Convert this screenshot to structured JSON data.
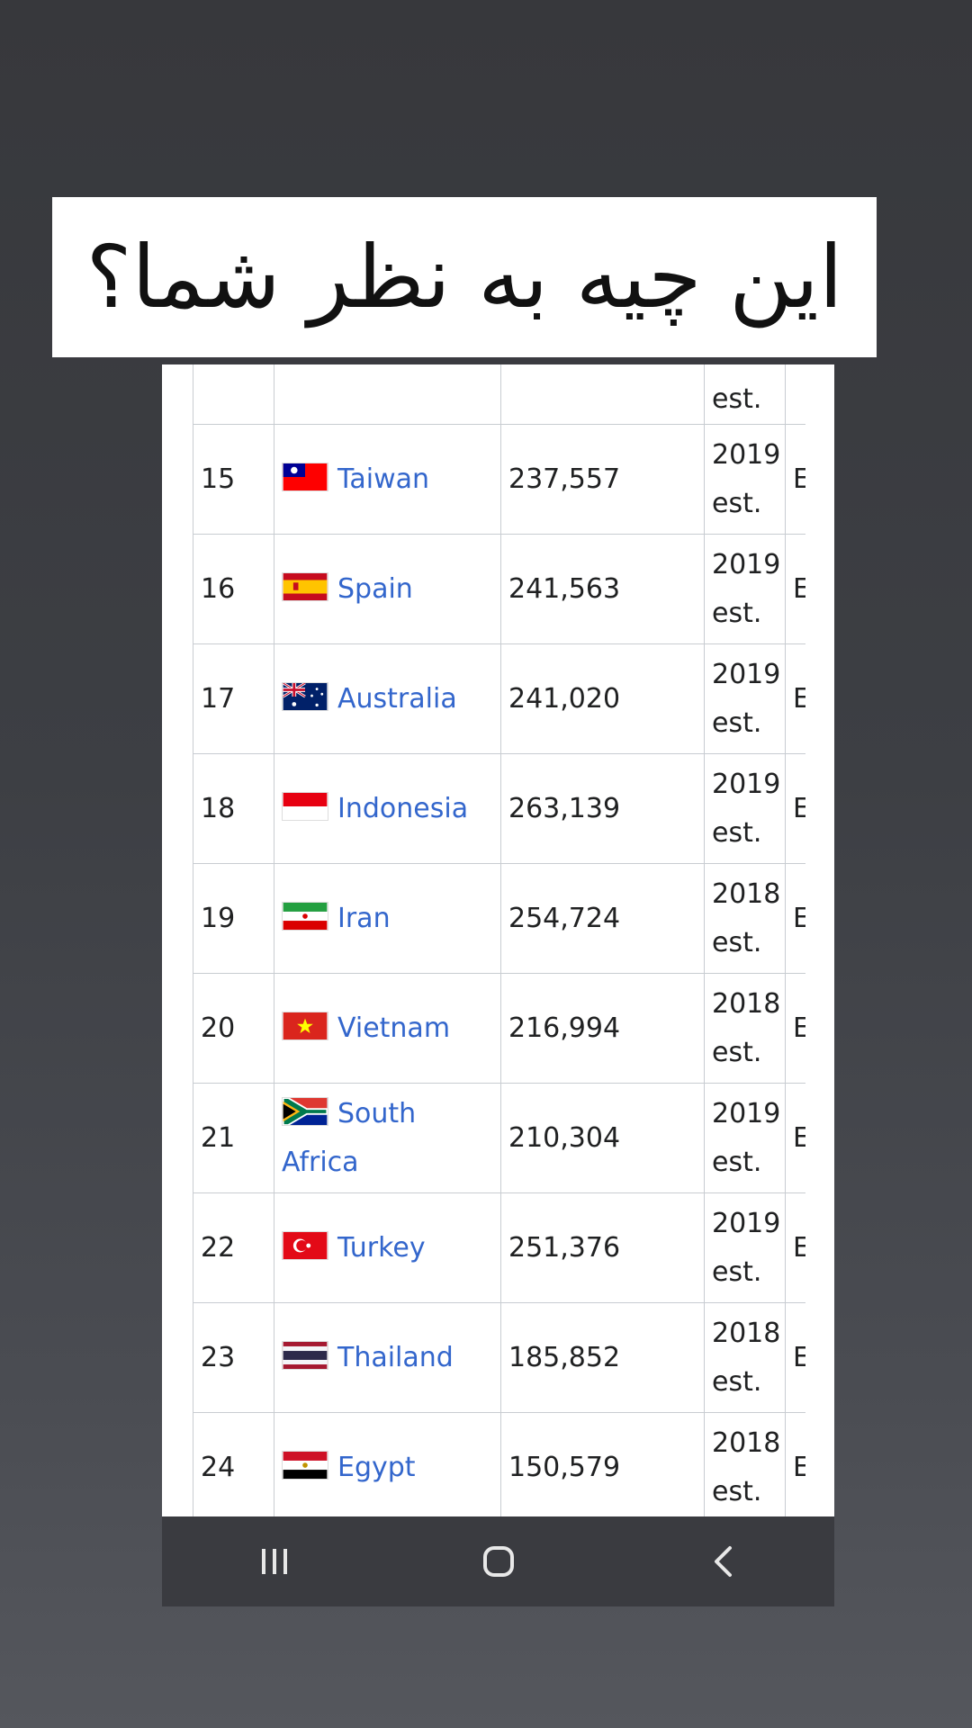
{
  "caption": {
    "text": "این چیه به نظر شما؟"
  },
  "table": {
    "top_partial": {
      "year_suffix": "est."
    },
    "rows": [
      {
        "rank": "15",
        "flag_icon": "taiwan-flag-icon",
        "country": "Taiwan",
        "value": "237,557",
        "year": "2019",
        "est": "est.",
        "trunc": "E"
      },
      {
        "rank": "16",
        "flag_icon": "spain-flag-icon",
        "country": "Spain",
        "value": "241,563",
        "year": "2019",
        "est": "est.",
        "trunc": "E"
      },
      {
        "rank": "17",
        "flag_icon": "australia-flag-icon",
        "country": "Australia",
        "value": "241,020",
        "year": "2019",
        "est": "est.",
        "trunc": "E"
      },
      {
        "rank": "18",
        "flag_icon": "indonesia-flag-icon",
        "country": "Indonesia",
        "value": "263,139",
        "year": "2019",
        "est": "est.",
        "trunc": "E"
      },
      {
        "rank": "19",
        "flag_icon": "iran-flag-icon",
        "country": "Iran",
        "value": "254,724",
        "year": "2018",
        "est": "est.",
        "trunc": "E"
      },
      {
        "rank": "20",
        "flag_icon": "vietnam-flag-icon",
        "country": "Vietnam",
        "value": "216,994",
        "year": "2018",
        "est": "est.",
        "trunc": "E"
      },
      {
        "rank": "21",
        "flag_icon": "south-africa-flag-icon",
        "country": "South Africa",
        "value": "210,304",
        "year": "2019",
        "est": "est.",
        "trunc": "E"
      },
      {
        "rank": "22",
        "flag_icon": "turkey-flag-icon",
        "country": "Turkey",
        "value": "251,376",
        "year": "2019",
        "est": "est.",
        "trunc": "E"
      },
      {
        "rank": "23",
        "flag_icon": "thailand-flag-icon",
        "country": "Thailand",
        "value": "185,852",
        "year": "2018",
        "est": "est.",
        "trunc": "E"
      },
      {
        "rank": "24",
        "flag_icon": "egypt-flag-icon",
        "country": "Egypt",
        "value": "150,579",
        "year": "2018",
        "est": "est.",
        "trunc": "E"
      }
    ]
  },
  "navbar": {
    "recents_icon": "recent-apps-icon",
    "home_icon": "home-icon",
    "back_icon": "back-icon"
  },
  "colors": {
    "link": "#3366cc",
    "navbar": "#3a3b40",
    "background": "#3d3f44"
  }
}
